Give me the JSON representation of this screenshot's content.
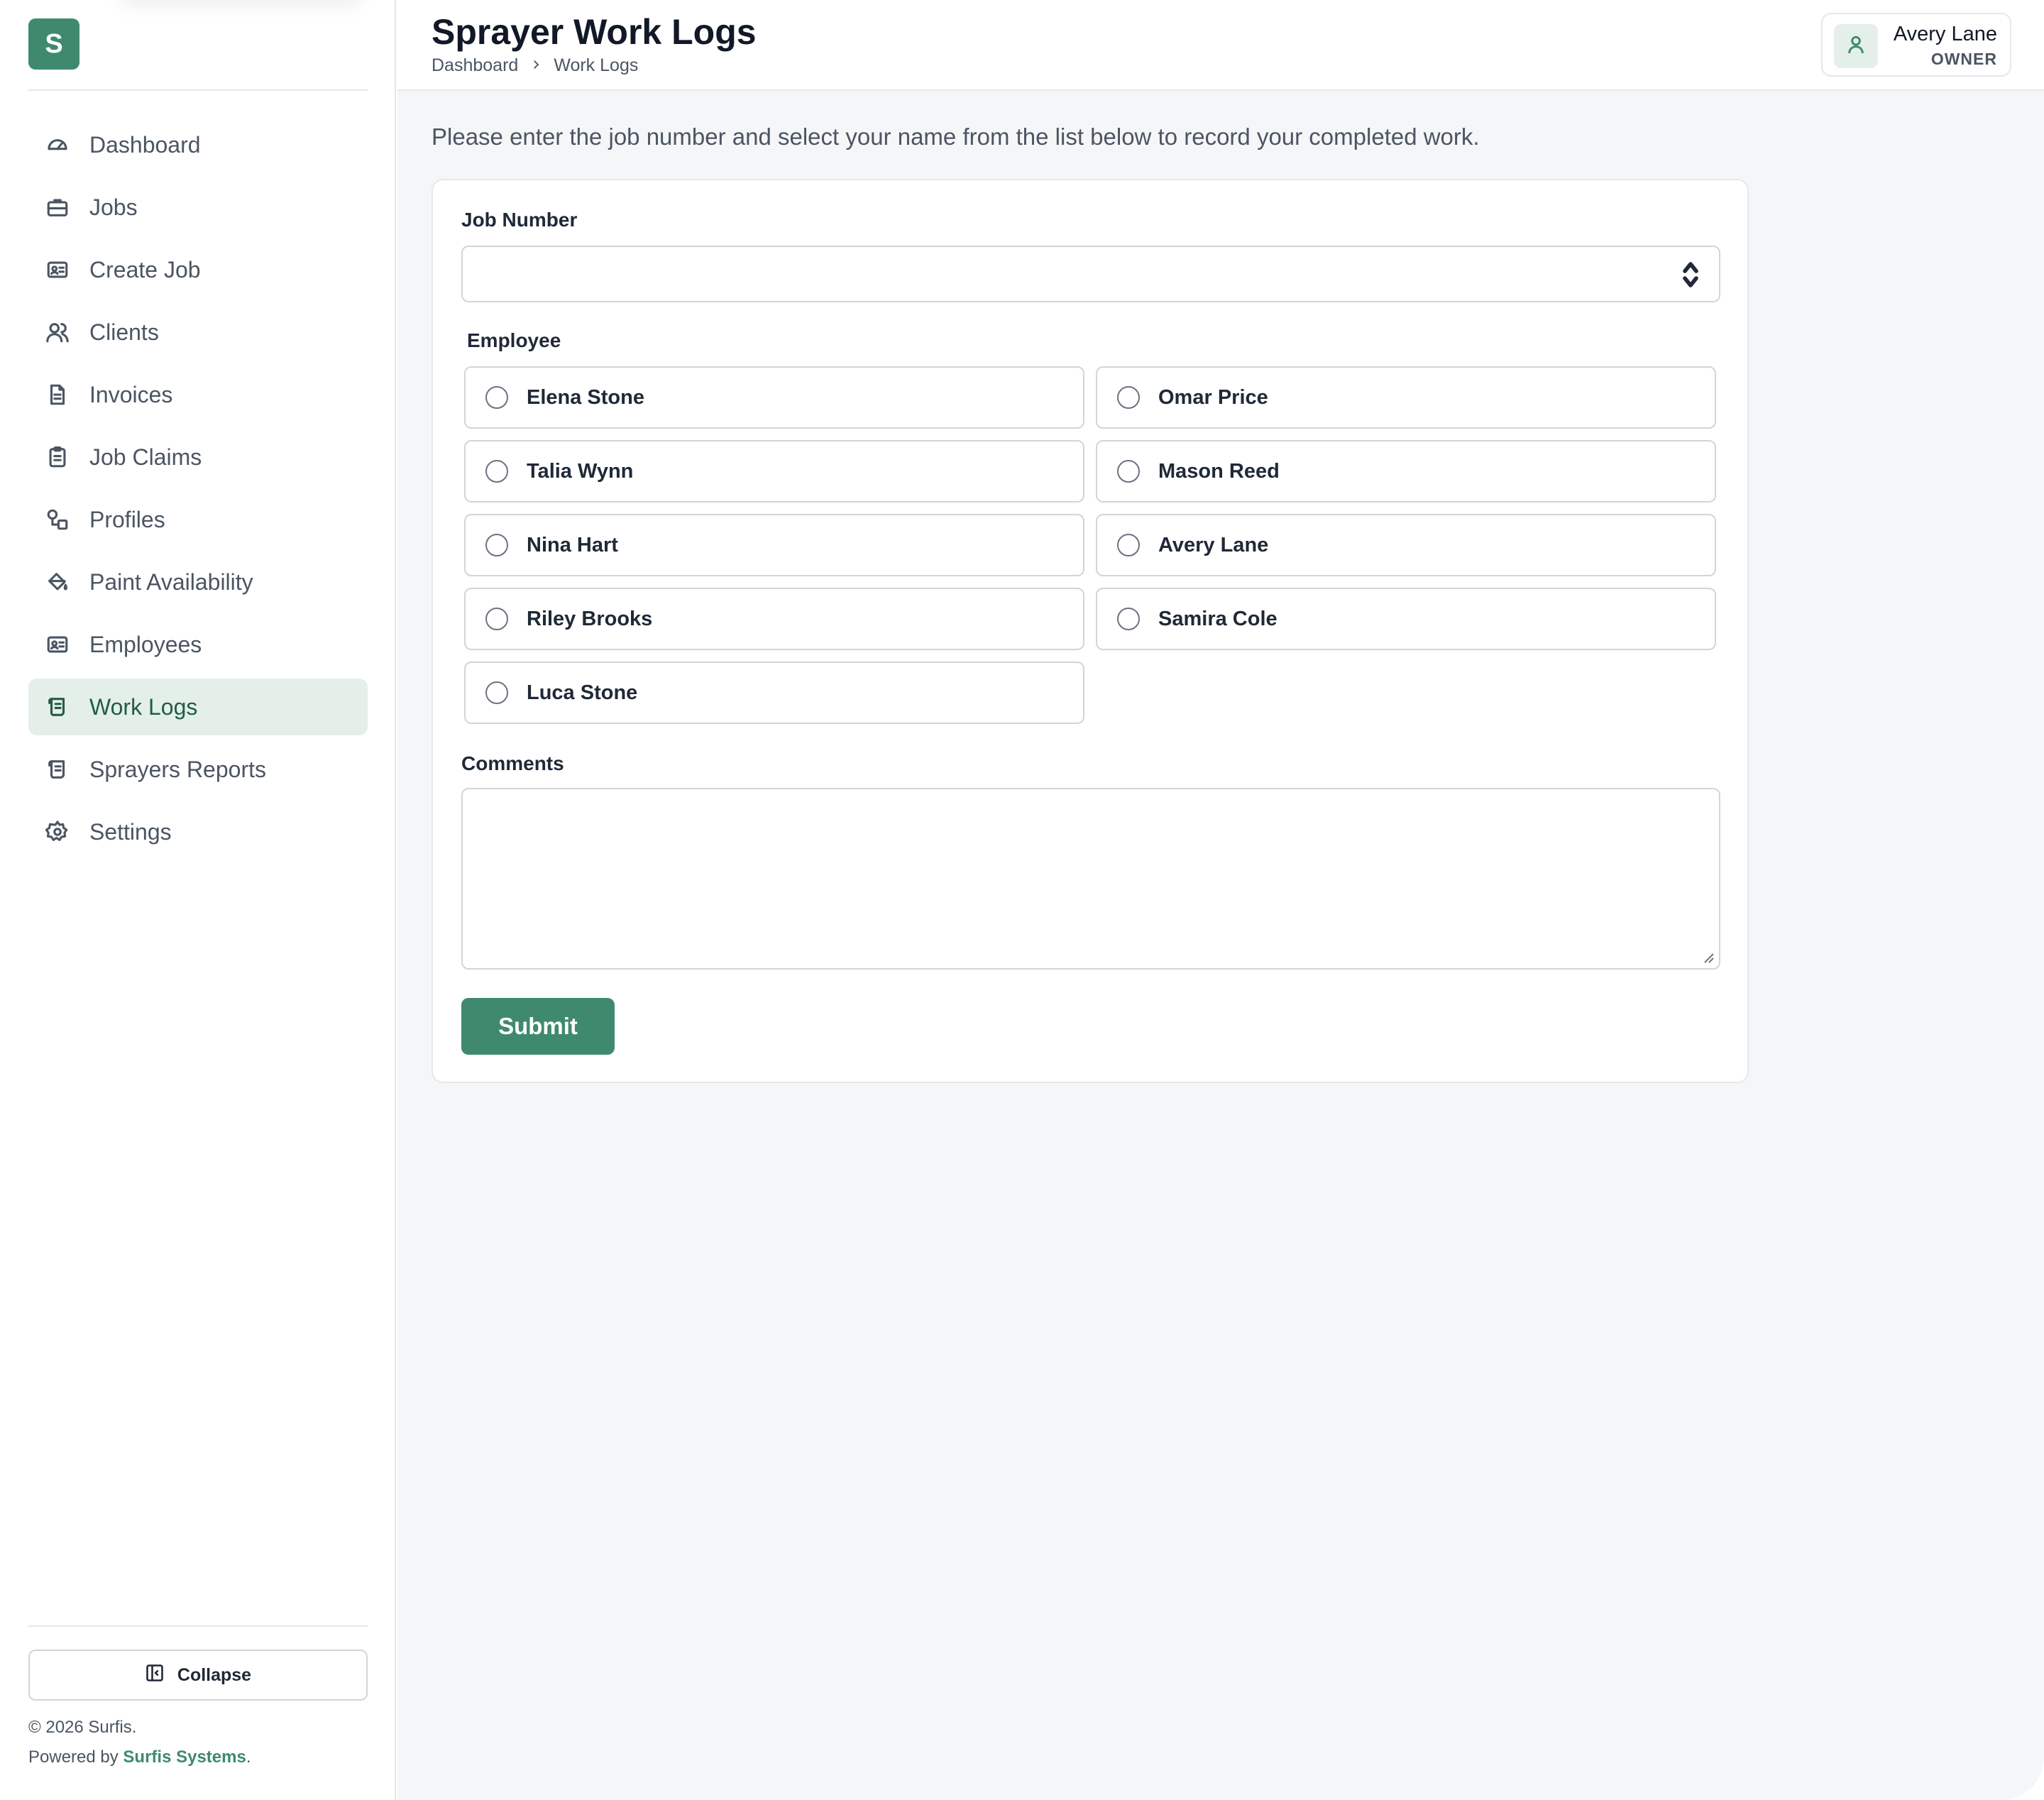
{
  "app": {
    "logo_letter": "S"
  },
  "sidebar": {
    "items": [
      {
        "label": "Dashboard",
        "icon": "gauge-icon"
      },
      {
        "label": "Jobs",
        "icon": "briefcase-icon"
      },
      {
        "label": "Create Job",
        "icon": "id-card-icon"
      },
      {
        "label": "Clients",
        "icon": "users-icon"
      },
      {
        "label": "Invoices",
        "icon": "file-text-icon"
      },
      {
        "label": "Job Claims",
        "icon": "clipboard-icon"
      },
      {
        "label": "Profiles",
        "icon": "shapes-icon"
      },
      {
        "label": "Paint Availability",
        "icon": "paint-bucket-icon"
      },
      {
        "label": "Employees",
        "icon": "id-card-icon"
      },
      {
        "label": "Work Logs",
        "icon": "scroll-icon",
        "active": true
      },
      {
        "label": "Sprayers Reports",
        "icon": "scroll-icon"
      },
      {
        "label": "Settings",
        "icon": "gear-icon"
      }
    ],
    "collapse_label": "Collapse",
    "footer": {
      "copyright": "© 2026 Surfis.",
      "powered_prefix": "Powered by ",
      "powered_brand": "Surfis Systems",
      "powered_suffix": "."
    }
  },
  "header": {
    "title": "Sprayer Work Logs",
    "breadcrumb": [
      "Dashboard",
      "Work Logs"
    ],
    "user": {
      "name": "Avery Lane",
      "role": "OWNER"
    }
  },
  "main": {
    "intro": "Please enter the job number and select your name from the list below to record your completed work.",
    "form": {
      "job_number_label": "Job Number",
      "job_number_value": "",
      "employee_label": "Employee",
      "employees": [
        "Elena Stone",
        "Omar Price",
        "Talia Wynn",
        "Mason Reed",
        "Nina Hart",
        "Avery Lane",
        "Riley Brooks",
        "Samira Cole",
        "Luca Stone"
      ],
      "comments_label": "Comments",
      "comments_value": "",
      "submit_label": "Submit"
    }
  },
  "colors": {
    "accent": "#3f8a6e",
    "active_bg": "#e4efe9",
    "active_text": "#245c46"
  }
}
